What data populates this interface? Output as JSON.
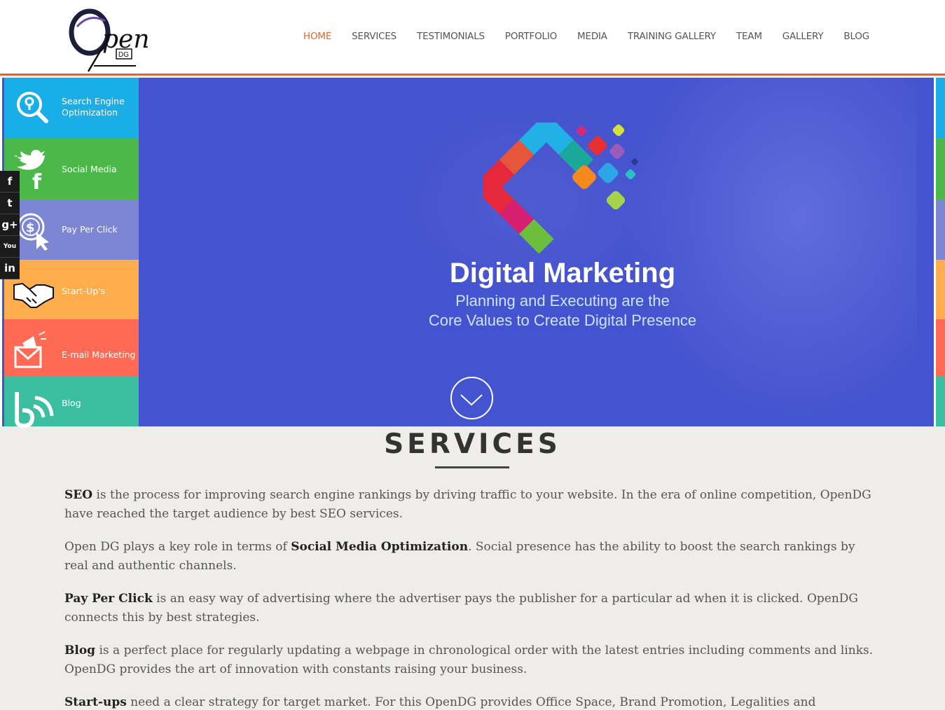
{
  "header": {
    "logo_text": "Open",
    "logo_sub": "DG",
    "nav": [
      {
        "label": "HOME",
        "active": true
      },
      {
        "label": "SERVICES",
        "active": false
      },
      {
        "label": "TESTIMONIALS",
        "active": false
      },
      {
        "label": "PORTFOLIO",
        "active": false
      },
      {
        "label": "MEDIA",
        "active": false
      },
      {
        "label": "TRAINING GALLERY",
        "active": false
      },
      {
        "label": "TEAM",
        "active": false
      },
      {
        "label": "GALLERY",
        "active": false
      },
      {
        "label": "BLOG",
        "active": false
      }
    ]
  },
  "service_menu": [
    {
      "label": "Search Engine Optimization",
      "icon": "search-icon",
      "color": "#19aee8"
    },
    {
      "label": "Social Media",
      "icon": "twitter-facebook-icon",
      "color": "#4cb849"
    },
    {
      "label": "Pay Per Click",
      "icon": "pay-per-click-icon",
      "color": "#7c86d3"
    },
    {
      "label": "Start-Up's",
      "icon": "handshake-icon",
      "color": "#ffac4d"
    },
    {
      "label": "E-mail Marketing",
      "icon": "email-megaphone-icon",
      "color": "#ff6a55"
    },
    {
      "label": "Blog",
      "icon": "blog-icon",
      "color": "#3cbfa1"
    }
  ],
  "social": [
    {
      "icon": "facebook-icon",
      "glyph": "f"
    },
    {
      "icon": "twitter-icon",
      "glyph": "t"
    },
    {
      "icon": "google-plus-icon",
      "glyph": "g+"
    },
    {
      "icon": "youtube-icon",
      "glyph": "You"
    },
    {
      "icon": "linkedin-icon",
      "glyph": "in"
    }
  ],
  "hero": {
    "title": "Digital Marketing",
    "subtitle_line1": "Planning and Executing are the",
    "subtitle_line2": "Core Values to Create Digital Presence",
    "bg_color": "#4453cf"
  },
  "services": {
    "title": "SERVICES",
    "paragraphs": [
      {
        "pre": "",
        "bold": "SEO",
        "post": " is the process for improving search engine rankings by driving traffic to your website. In the era of online competition, OpenDG have reached the target audience by best SEO services."
      },
      {
        "pre": "Open DG plays a key role in terms of ",
        "bold": "Social Media Optimization",
        "post": ".  Social presence has the ability to boost the search rankings by real and authentic channels."
      },
      {
        "pre": "",
        "bold": "Pay Per Click",
        "post": " is an easy way of advertising where the advertiser pays the publisher for a particular ad when it is clicked. OpenDG connects this by best strategies."
      },
      {
        "pre": "",
        "bold": "Blog",
        "post": " is a perfect place for regularly updating a webpage in chronological order with the latest entries including comments and links. OpenDG provides the art of innovation with constants raising your business."
      },
      {
        "pre": "",
        "bold": "Start-ups",
        "post": " need a clear strategy for target market. For this OpenDG provides Office Space, Brand Promotion, Legalities and registration,"
      }
    ]
  },
  "colors": {
    "accent": "#e8632c",
    "hero": "#4453cf"
  }
}
